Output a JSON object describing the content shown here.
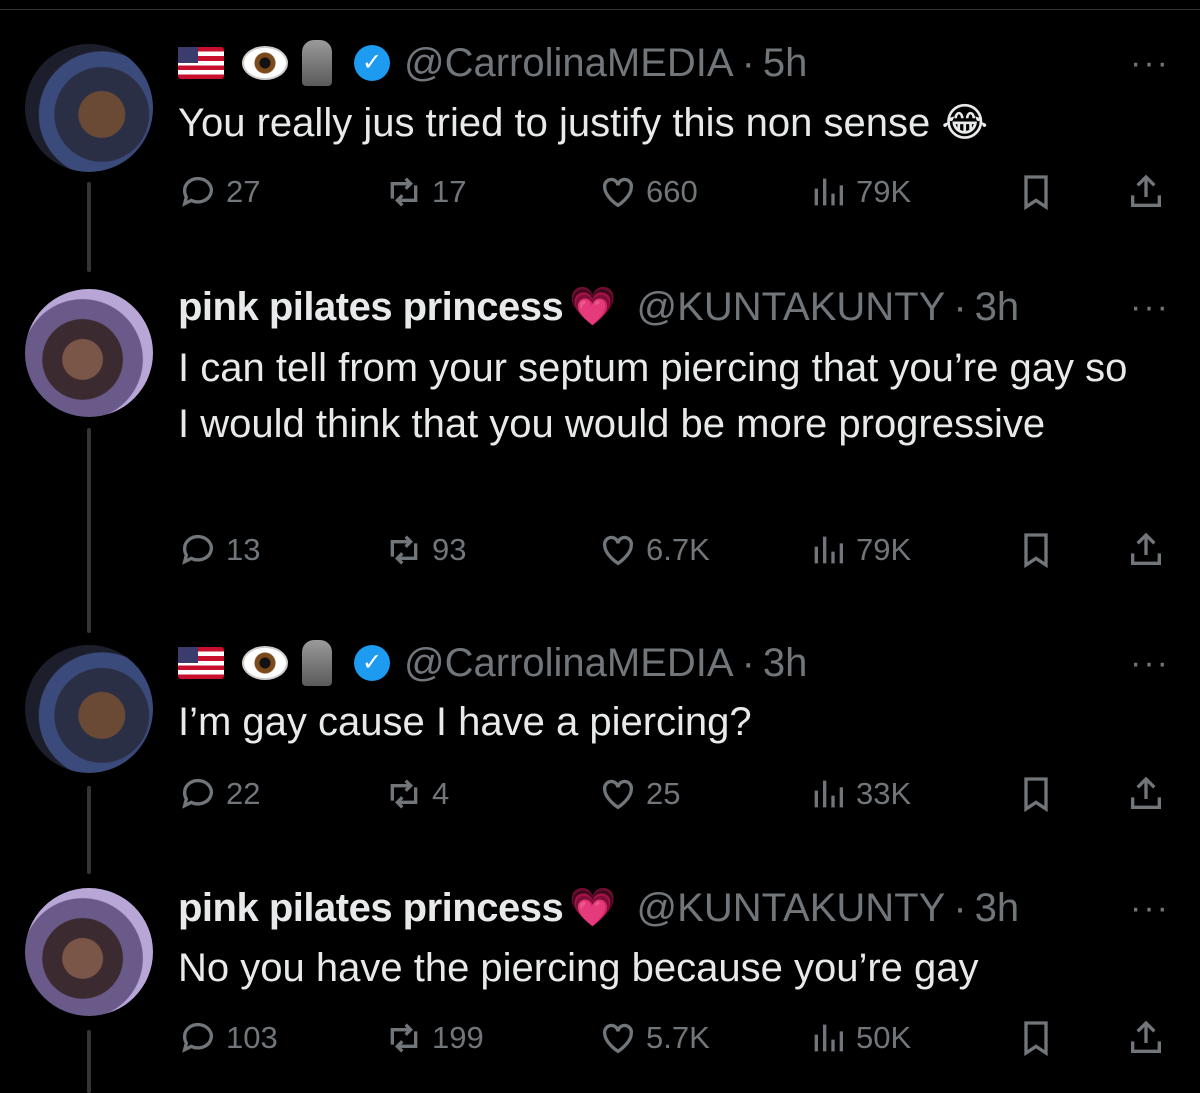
{
  "tweets": [
    {
      "author_type": "man",
      "name": "",
      "name_emojis": [
        "flag-usa-icon",
        "eye-icon",
        "moai-icon"
      ],
      "verified": true,
      "handle": "@CarrolinaMEDIA",
      "separator": "·",
      "time": "5h",
      "text": "You really jus tried to justify this non sense 😂",
      "more": "···",
      "stats": {
        "replies": "27",
        "reposts": "17",
        "likes": "660",
        "views": "79K"
      }
    },
    {
      "author_type": "woman",
      "name": "pink pilates princess",
      "name_suffix": "💗",
      "verified": false,
      "handle": "@KUNTAKUNTY",
      "separator": "·",
      "time": "3h",
      "text": "I can tell from your septum piercing that you’re gay so I would think that you would be more progressive",
      "more": "···",
      "stats": {
        "replies": "13",
        "reposts": "93",
        "likes": "6.7K",
        "views": "79K"
      }
    },
    {
      "author_type": "man",
      "name": "",
      "name_emojis": [
        "flag-usa-icon",
        "eye-icon",
        "moai-icon"
      ],
      "verified": true,
      "handle": "@CarrolinaMEDIA",
      "separator": "·",
      "time": "3h",
      "text": "I’m gay cause I have a piercing?",
      "more": "···",
      "stats": {
        "replies": "22",
        "reposts": "4",
        "likes": "25",
        "views": "33K"
      }
    },
    {
      "author_type": "woman",
      "name": "pink pilates princess",
      "name_suffix": "💗",
      "verified": false,
      "handle": "@KUNTAKUNTY",
      "separator": "·",
      "time": "3h",
      "text": "No you have the piercing because you’re gay",
      "more": "···",
      "stats": {
        "replies": "103",
        "reposts": "199",
        "likes": "5.7K",
        "views": "50K"
      }
    }
  ],
  "colors": {
    "background": "#000000",
    "text": "#e7e9ea",
    "muted": "#71767b",
    "verified": "#1d9bf0",
    "heart": "#f77fc5"
  }
}
